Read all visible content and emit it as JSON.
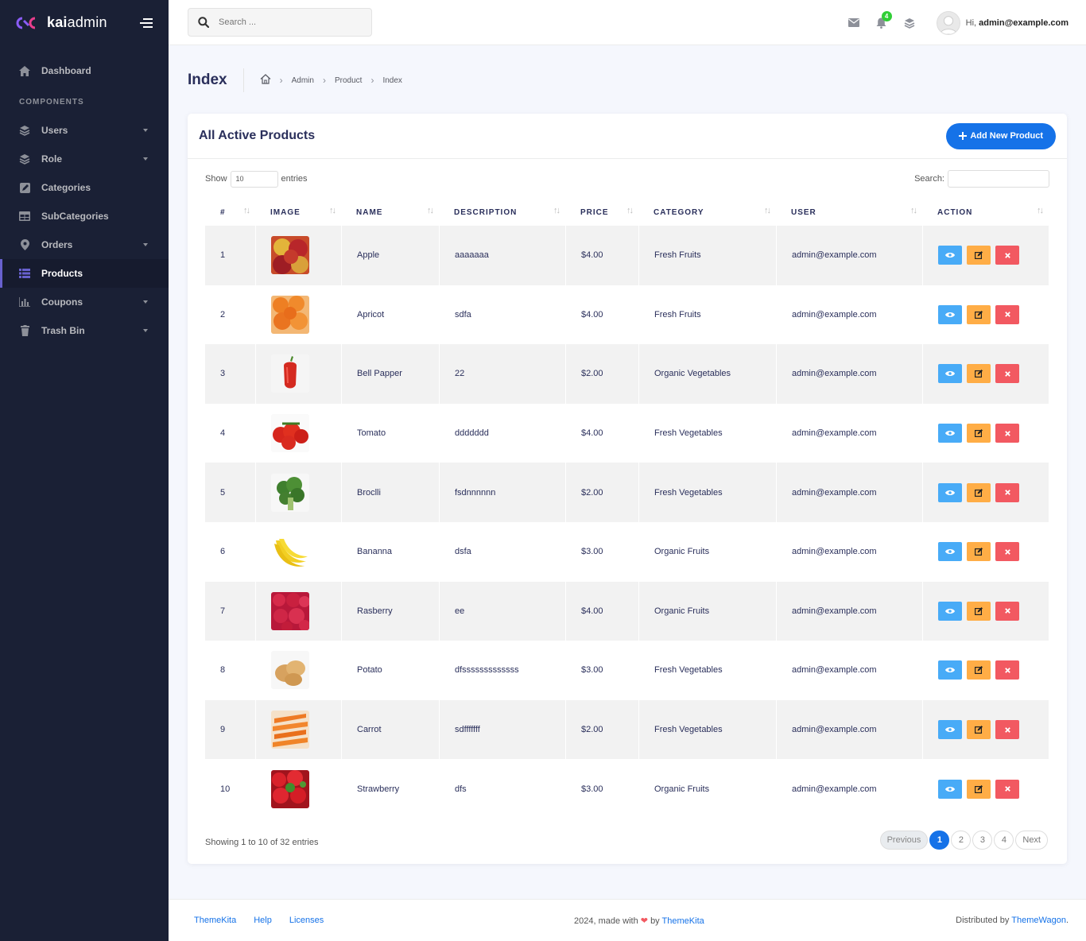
{
  "brand": {
    "bold": "kai",
    "rest": "admin"
  },
  "nav": {
    "dashboard": "Dashboard",
    "section": "COMPONENTS",
    "items": [
      {
        "label": "Users",
        "icon": "layers-icon",
        "caret": true
      },
      {
        "label": "Role",
        "icon": "layers-icon",
        "caret": true
      },
      {
        "label": "Categories",
        "icon": "pen-square-icon",
        "caret": false
      },
      {
        "label": "SubCategories",
        "icon": "table-icon",
        "caret": false
      },
      {
        "label": "Orders",
        "icon": "map-marker-icon",
        "caret": true
      },
      {
        "label": "Products",
        "icon": "list-icon",
        "caret": false,
        "active": true
      },
      {
        "label": "Coupons",
        "icon": "bar-chart-icon",
        "caret": true
      },
      {
        "label": "Trash Bin",
        "icon": "trash-icon",
        "caret": true
      }
    ]
  },
  "header": {
    "search_placeholder": "Search ...",
    "notif_count": "4",
    "greeting": "Hi,",
    "user": "admin@example.com"
  },
  "page": {
    "title": "Index",
    "crumbs": [
      "Admin",
      "Product",
      "Index"
    ]
  },
  "card": {
    "title": "All Active Products",
    "add_label": "Add New Product",
    "show_label": "Show",
    "show_value": "10",
    "entries_label": "entries",
    "search_label": "Search:"
  },
  "table": {
    "columns": [
      "#",
      "IMAGE",
      "NAME",
      "DESCRIPTION",
      "PRICE",
      "CATEGORY",
      "USER",
      "ACTION"
    ],
    "rows": [
      {
        "no": "1",
        "img": "apple",
        "name": "Apple",
        "desc": "aaaaaaa",
        "price": "$4.00",
        "category": "Fresh Fruits",
        "user": "admin@example.com"
      },
      {
        "no": "2",
        "img": "apricot",
        "name": "Apricot",
        "desc": "sdfa",
        "price": "$4.00",
        "category": "Fresh Fruits",
        "user": "admin@example.com"
      },
      {
        "no": "3",
        "img": "pepper",
        "name": "Bell Papper",
        "desc": "22",
        "price": "$2.00",
        "category": "Organic Vegetables",
        "user": "admin@example.com"
      },
      {
        "no": "4",
        "img": "tomato",
        "name": "Tomato",
        "desc": "ddddddd",
        "price": "$4.00",
        "category": "Fresh Vegetables",
        "user": "admin@example.com"
      },
      {
        "no": "5",
        "img": "broccoli",
        "name": "Broclli",
        "desc": "fsdnnnnnn",
        "price": "$2.00",
        "category": "Fresh Vegetables",
        "user": "admin@example.com"
      },
      {
        "no": "6",
        "img": "banana",
        "name": "Bananna",
        "desc": "dsfa",
        "price": "$3.00",
        "category": "Organic Fruits",
        "user": "admin@example.com"
      },
      {
        "no": "7",
        "img": "raspberry",
        "name": "Rasberry",
        "desc": "ee",
        "price": "$4.00",
        "category": "Organic Fruits",
        "user": "admin@example.com"
      },
      {
        "no": "8",
        "img": "potato",
        "name": "Potato",
        "desc": "dfsssssssssssss",
        "price": "$3.00",
        "category": "Fresh Vegetables",
        "user": "admin@example.com"
      },
      {
        "no": "9",
        "img": "carrot",
        "name": "Carrot",
        "desc": "sdfffffff",
        "price": "$2.00",
        "category": "Fresh Vegetables",
        "user": "admin@example.com"
      },
      {
        "no": "10",
        "img": "strawberry",
        "name": "Strawberry",
        "desc": "dfs",
        "price": "$3.00",
        "category": "Organic Fruits",
        "user": "admin@example.com"
      }
    ]
  },
  "pager": {
    "info": "Showing 1 to 10 of 32 entries",
    "prev": "Previous",
    "pages": [
      "1",
      "2",
      "3",
      "4"
    ],
    "current": "1",
    "next": "Next"
  },
  "footer": {
    "links": [
      "ThemeKita",
      "Help",
      "Licenses"
    ],
    "made_prefix": "2024, made with",
    "made_by": "by",
    "made_link": "ThemeKita",
    "dist_prefix": "Distributed by",
    "dist_link": "ThemeWagon",
    "dist_suffix": "."
  },
  "colors": {
    "sidebar": "#1a2035",
    "primary": "#1572e8",
    "info": "#48abf7",
    "warning": "#ffad46",
    "danger": "#f25961",
    "success": "#31ce36"
  }
}
